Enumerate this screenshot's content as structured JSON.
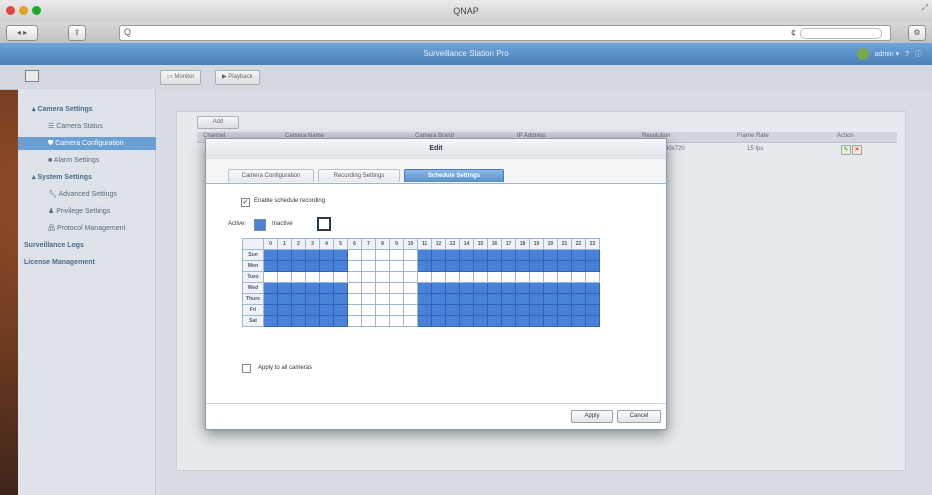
{
  "window": {
    "title": "QNAP"
  },
  "browser": {
    "url": "Q",
    "reload_icon": "¢"
  },
  "app": {
    "title": "Surveillance Station Pro",
    "user_label": "admin ▾",
    "help_icon": "?"
  },
  "subnav": {
    "monitor_label": "Monitor",
    "playback_label": "Playback"
  },
  "sidebar": {
    "items": [
      {
        "label": "▴ Camera Settings"
      },
      {
        "label": "Camera Status"
      },
      {
        "label": "Camera Configuration"
      },
      {
        "label": "Alarm Settings"
      },
      {
        "label": "▴ System Settings"
      },
      {
        "label": "Advanced Settings"
      },
      {
        "label": "Privilege Settings"
      },
      {
        "label": "Protocol Management"
      },
      {
        "label": "Surveillance Logs"
      },
      {
        "label": "License Management"
      }
    ]
  },
  "table": {
    "add_label": "Add",
    "headers": [
      "Channel",
      "Camera Name",
      "Camera Brand",
      "IP Address",
      "Resolution",
      "Frame Rate",
      "Action"
    ],
    "row": {
      "resolution": "80x720",
      "frame_rate": "15 fps"
    }
  },
  "modal": {
    "title": "Edit",
    "tabs": [
      "Camera Configuration",
      "Recording Settings",
      "Schedule Settings"
    ],
    "enable_label": "Enable schedule recording",
    "active_label": "Active:",
    "inactive_label": "Inactive",
    "hours": [
      "0",
      "1",
      "2",
      "3",
      "4",
      "5",
      "6",
      "7",
      "8",
      "9",
      "10",
      "11",
      "12",
      "13",
      "14",
      "15",
      "16",
      "17",
      "18",
      "19",
      "20",
      "21",
      "22",
      "23"
    ],
    "days": [
      {
        "name": "Sun",
        "schedule": [
          1,
          1,
          1,
          1,
          1,
          1,
          0,
          0,
          0,
          0,
          0,
          1,
          1,
          1,
          1,
          1,
          1,
          1,
          1,
          1,
          1,
          1,
          1,
          1
        ]
      },
      {
        "name": "Mon",
        "schedule": [
          1,
          1,
          1,
          1,
          1,
          1,
          0,
          0,
          0,
          0,
          0,
          1,
          1,
          1,
          1,
          1,
          1,
          1,
          1,
          1,
          1,
          1,
          1,
          1
        ]
      },
      {
        "name": "Tues",
        "schedule": [
          0,
          0,
          0,
          0,
          0,
          0,
          0,
          0,
          0,
          0,
          0,
          0,
          0,
          0,
          0,
          0,
          0,
          0,
          0,
          0,
          0,
          0,
          0,
          0
        ]
      },
      {
        "name": "Wed",
        "schedule": [
          1,
          1,
          1,
          1,
          1,
          1,
          0,
          0,
          0,
          0,
          0,
          1,
          1,
          1,
          1,
          1,
          1,
          1,
          1,
          1,
          1,
          1,
          1,
          1
        ]
      },
      {
        "name": "Thurs",
        "schedule": [
          1,
          1,
          1,
          1,
          1,
          1,
          0,
          0,
          0,
          0,
          0,
          1,
          1,
          1,
          1,
          1,
          1,
          1,
          1,
          1,
          1,
          1,
          1,
          1
        ]
      },
      {
        "name": "Fri",
        "schedule": [
          1,
          1,
          1,
          1,
          1,
          1,
          0,
          0,
          0,
          0,
          0,
          1,
          1,
          1,
          1,
          1,
          1,
          1,
          1,
          1,
          1,
          1,
          1,
          1
        ]
      },
      {
        "name": "Sat",
        "schedule": [
          1,
          1,
          1,
          1,
          1,
          1,
          0,
          0,
          0,
          0,
          0,
          1,
          1,
          1,
          1,
          1,
          1,
          1,
          1,
          1,
          1,
          1,
          1,
          1
        ]
      }
    ],
    "apply_all_label": "Apply to all cameras",
    "apply_label": "Apply",
    "cancel_label": "Cancel"
  },
  "colors": {
    "active": "#4a82d8",
    "inactive": "#ffffff",
    "header": "#5a90cc"
  }
}
